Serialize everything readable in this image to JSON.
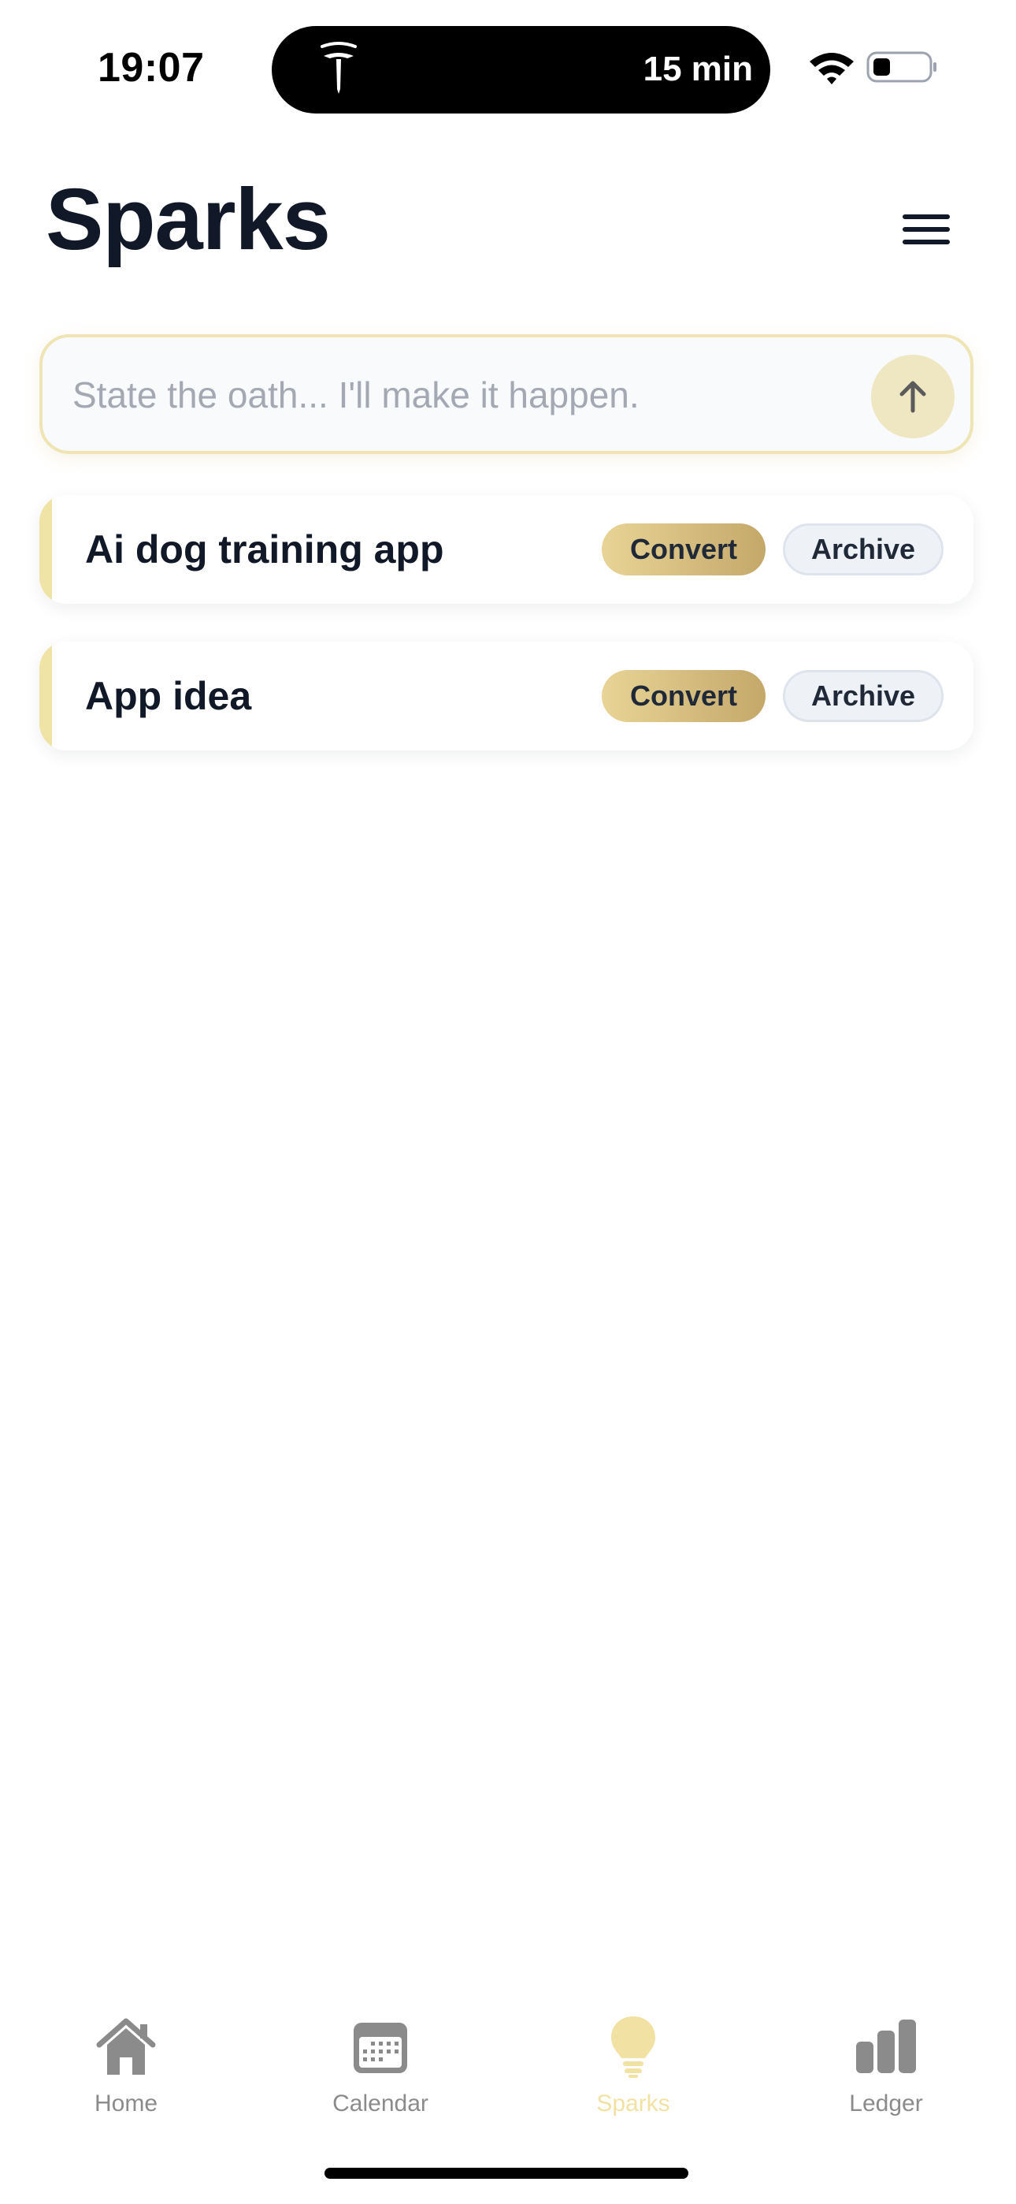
{
  "status_bar": {
    "time": "19:07",
    "island_text": "15 min"
  },
  "header": {
    "title": "Sparks"
  },
  "composer": {
    "placeholder": "State the oath... I'll make it happen."
  },
  "sparks": [
    {
      "title": "Ai dog training app",
      "convert_label": "Convert",
      "archive_label": "Archive"
    },
    {
      "title": "App idea",
      "convert_label": "Convert",
      "archive_label": "Archive"
    }
  ],
  "tab_bar": {
    "tabs": [
      {
        "label": "Home",
        "icon": "home-icon",
        "active": false
      },
      {
        "label": "Calendar",
        "icon": "calendar-icon",
        "active": false
      },
      {
        "label": "Sparks",
        "icon": "lightbulb-icon",
        "active": true
      },
      {
        "label": "Ledger",
        "icon": "bar-chart-icon",
        "active": false
      }
    ]
  },
  "colors": {
    "accent_gold": "#e8d496",
    "accent_gold_dark": "#c4a86a",
    "active_tab": "#f1e2a4",
    "inactive_tab": "#8b8b8b",
    "title_text": "#111827"
  }
}
